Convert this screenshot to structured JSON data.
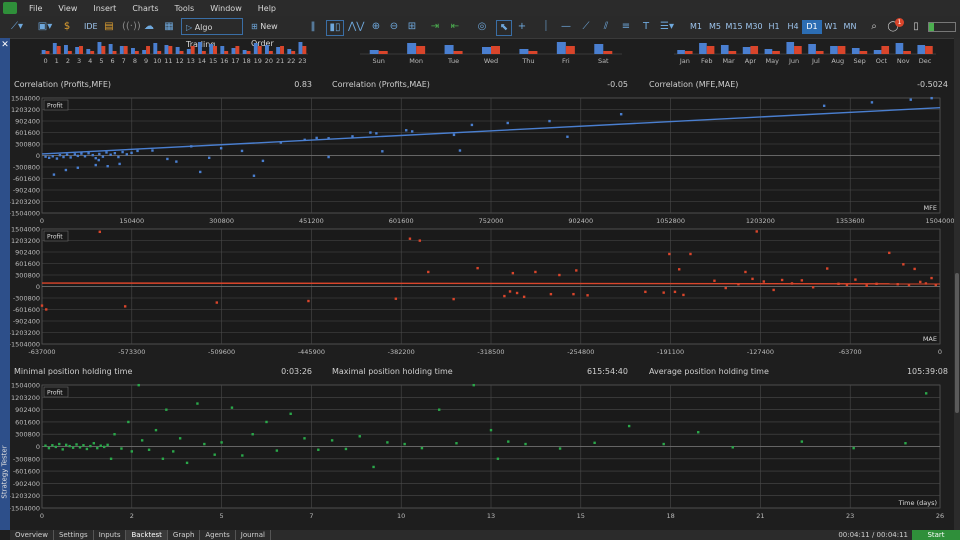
{
  "menu": [
    "File",
    "View",
    "Insert",
    "Charts",
    "Tools",
    "Window",
    "Help"
  ],
  "toolbar": {
    "ide": "IDE",
    "algo": "Algo Trading",
    "new_order": "New Order",
    "timeframes": [
      "M1",
      "M5",
      "M15",
      "M30",
      "H1",
      "H4",
      "D1",
      "W1",
      "MN"
    ],
    "active_tf": "D1",
    "notif_count": "1"
  },
  "top_hist": {
    "hours": [
      "0",
      "1",
      "2",
      "3",
      "4",
      "5",
      "6",
      "7",
      "8",
      "9",
      "10",
      "11",
      "12",
      "13",
      "14",
      "15",
      "16",
      "17",
      "18",
      "19",
      "20",
      "21",
      "22",
      "23"
    ],
    "days": [
      "Sun",
      "Mon",
      "Tue",
      "Wed",
      "Thu",
      "Fri",
      "Sat"
    ],
    "months": [
      "Jan",
      "Feb",
      "Mar",
      "Apr",
      "May",
      "Jun",
      "Jul",
      "Aug",
      "Sep",
      "Oct",
      "Nov",
      "Dec"
    ]
  },
  "stats1": [
    {
      "label": "Correlation (Profits,MFE)",
      "value": "0.83"
    },
    {
      "label": "Correlation (Profits,MAE)",
      "value": "-0.05"
    },
    {
      "label": "Correlation (MFE,MAE)",
      "value": "-0.5024"
    }
  ],
  "stats2": [
    {
      "label": "Minimal position holding time",
      "value": "0:03:26"
    },
    {
      "label": "Maximal position holding time",
      "value": "615:54:40"
    },
    {
      "label": "Average position holding time",
      "value": "105:39:08"
    }
  ],
  "colors": {
    "mfe": "#4a7fd0",
    "mae": "#d9452b",
    "time": "#2aa84a",
    "buy": "#4a7fd0",
    "sell": "#d9452b"
  },
  "chart_data": [
    {
      "type": "scatter",
      "title": "",
      "legend": "Profit",
      "xlabel": "MFE",
      "ylabel": "",
      "yticks": [
        "1504000",
        "1203200",
        "902400",
        "601600",
        "300800",
        "0",
        "-300800",
        "-601600",
        "-902400",
        "-1203200",
        "-1504000"
      ],
      "xticks": [
        "0",
        "150400",
        "300800",
        "451200",
        "601600",
        "752000",
        "902400",
        "1052800",
        "1203200",
        "1353600",
        "1504000"
      ],
      "xlim": [
        0,
        1504000
      ],
      "ylim": [
        -1504000,
        1504000
      ],
      "trend": [
        [
          0,
          40000
        ],
        [
          1504000,
          1250000
        ]
      ],
      "points": [
        [
          6000,
          -30000
        ],
        [
          12000,
          -60000
        ],
        [
          18000,
          -20000
        ],
        [
          25000,
          -80000
        ],
        [
          30000,
          10000
        ],
        [
          36000,
          -40000
        ],
        [
          42000,
          20000
        ],
        [
          48000,
          -50000
        ],
        [
          55000,
          30000
        ],
        [
          60000,
          -10000
        ],
        [
          66000,
          50000
        ],
        [
          72000,
          -20000
        ],
        [
          78000,
          60000
        ],
        [
          85000,
          10000
        ],
        [
          90000,
          -70000
        ],
        [
          96000,
          40000
        ],
        [
          102000,
          -30000
        ],
        [
          108000,
          80000
        ],
        [
          115000,
          20000
        ],
        [
          122000,
          60000
        ],
        [
          128000,
          -40000
        ],
        [
          135000,
          90000
        ],
        [
          142000,
          30000
        ],
        [
          150000,
          70000
        ],
        [
          20000,
          -500000
        ],
        [
          40000,
          -380000
        ],
        [
          60000,
          -320000
        ],
        [
          90000,
          -250000
        ],
        [
          110000,
          -280000
        ],
        [
          130000,
          -220000
        ],
        [
          95000,
          -120000
        ],
        [
          160000,
          120000
        ],
        [
          185000,
          130000
        ],
        [
          210000,
          -90000
        ],
        [
          225000,
          -160000
        ],
        [
          250000,
          240000
        ],
        [
          265000,
          -430000
        ],
        [
          280000,
          -60000
        ],
        [
          300000,
          190000
        ],
        [
          335000,
          120000
        ],
        [
          355000,
          -530000
        ],
        [
          370000,
          -140000
        ],
        [
          400000,
          340000
        ],
        [
          440000,
          410000
        ],
        [
          460000,
          460000
        ],
        [
          480000,
          450000
        ],
        [
          520000,
          500000
        ],
        [
          480000,
          -40000
        ],
        [
          550000,
          600000
        ],
        [
          560000,
          580000
        ],
        [
          570000,
          110000
        ],
        [
          610000,
          660000
        ],
        [
          620000,
          630000
        ],
        [
          690000,
          540000
        ],
        [
          720000,
          800000
        ],
        [
          700000,
          130000
        ],
        [
          780000,
          850000
        ],
        [
          850000,
          900000
        ],
        [
          880000,
          490000
        ],
        [
          970000,
          1080000
        ],
        [
          1310000,
          1300000
        ],
        [
          1390000,
          1390000
        ],
        [
          1455000,
          1460000
        ],
        [
          1490000,
          1500000
        ]
      ]
    },
    {
      "type": "scatter",
      "title": "",
      "legend": "Profit",
      "xlabel": "MAE",
      "ylabel": "",
      "yticks": [
        "1504000",
        "1203200",
        "902400",
        "601600",
        "300800",
        "0",
        "-300800",
        "-601600",
        "-902400",
        "-1203200",
        "-1504000"
      ],
      "xticks": [
        "-637000",
        "-573300",
        "-509600",
        "-445900",
        "-382200",
        "-318500",
        "-254800",
        "-191100",
        "-127400",
        "-63700",
        "0"
      ],
      "xlim": [
        -637000,
        0
      ],
      "ylim": [
        -1504000,
        1504000
      ],
      "trend": [
        [
          -637000,
          90000
        ],
        [
          0,
          70000
        ]
      ],
      "points": [
        [
          -637000,
          -500000
        ],
        [
          -634000,
          -600000
        ],
        [
          -596000,
          1430000
        ],
        [
          -578000,
          -520000
        ],
        [
          -513000,
          -420000
        ],
        [
          -448000,
          -380000
        ],
        [
          -386000,
          -320000
        ],
        [
          -376000,
          1250000
        ],
        [
          -369000,
          1200000
        ],
        [
          -363000,
          380000
        ],
        [
          -345000,
          -330000
        ],
        [
          -328000,
          480000
        ],
        [
          -309000,
          -250000
        ],
        [
          -305000,
          -130000
        ],
        [
          -303000,
          350000
        ],
        [
          -300000,
          -170000
        ],
        [
          -295000,
          -270000
        ],
        [
          -287000,
          380000
        ],
        [
          -276000,
          -200000
        ],
        [
          -270000,
          300000
        ],
        [
          -260000,
          -200000
        ],
        [
          -258000,
          420000
        ],
        [
          -250000,
          -230000
        ],
        [
          -209000,
          -140000
        ],
        [
          -196000,
          -160000
        ],
        [
          -192000,
          850000
        ],
        [
          -188000,
          -140000
        ],
        [
          -185000,
          450000
        ],
        [
          -182000,
          -220000
        ],
        [
          -177000,
          850000
        ],
        [
          -130000,
          1440000
        ],
        [
          -160000,
          150000
        ],
        [
          -152000,
          -40000
        ],
        [
          -143000,
          60000
        ],
        [
          -138000,
          380000
        ],
        [
          -133000,
          200000
        ],
        [
          -125000,
          130000
        ],
        [
          -118000,
          -90000
        ],
        [
          -112000,
          170000
        ],
        [
          -105000,
          80000
        ],
        [
          -98000,
          160000
        ],
        [
          -90000,
          -20000
        ],
        [
          -80000,
          470000
        ],
        [
          -72000,
          70000
        ],
        [
          -66000,
          40000
        ],
        [
          -60000,
          180000
        ],
        [
          -52000,
          20000
        ],
        [
          -45000,
          70000
        ],
        [
          -36000,
          880000
        ],
        [
          -30000,
          60000
        ],
        [
          -26000,
          580000
        ],
        [
          -22000,
          40000
        ],
        [
          -18000,
          460000
        ],
        [
          -14000,
          120000
        ],
        [
          -10000,
          80000
        ],
        [
          -6000,
          220000
        ],
        [
          -3000,
          40000
        ]
      ]
    },
    {
      "type": "scatter",
      "title": "",
      "legend": "Profit",
      "xlabel": "Time (days)",
      "ylabel": "",
      "yticks": [
        "1504000",
        "1203200",
        "902400",
        "601600",
        "300800",
        "0",
        "-300800",
        "-601600",
        "-902400",
        "-1203200",
        "-1504000"
      ],
      "xticks": [
        "0",
        "2",
        "5",
        "7",
        "10",
        "13",
        "15",
        "18",
        "21",
        "23",
        "26"
      ],
      "xlim": [
        0,
        26
      ],
      "ylim": [
        -1504000,
        1504000
      ],
      "points": [
        [
          0.1,
          20000
        ],
        [
          0.2,
          -40000
        ],
        [
          0.3,
          30000
        ],
        [
          0.4,
          -10000
        ],
        [
          0.5,
          60000
        ],
        [
          0.6,
          -70000
        ],
        [
          0.7,
          40000
        ],
        [
          0.8,
          10000
        ],
        [
          0.9,
          -30000
        ],
        [
          1.0,
          50000
        ],
        [
          1.1,
          -20000
        ],
        [
          1.2,
          30000
        ],
        [
          1.3,
          -60000
        ],
        [
          1.4,
          10000
        ],
        [
          1.5,
          80000
        ],
        [
          1.6,
          -40000
        ],
        [
          1.7,
          20000
        ],
        [
          1.8,
          -10000
        ],
        [
          1.9,
          40000
        ],
        [
          2.0,
          -300000
        ],
        [
          2.1,
          300000
        ],
        [
          2.3,
          -50000
        ],
        [
          2.5,
          600000
        ],
        [
          2.6,
          -120000
        ],
        [
          2.8,
          1500000
        ],
        [
          2.9,
          150000
        ],
        [
          3.1,
          -80000
        ],
        [
          3.3,
          400000
        ],
        [
          3.5,
          -300000
        ],
        [
          3.6,
          900000
        ],
        [
          3.8,
          -120000
        ],
        [
          4.0,
          200000
        ],
        [
          4.2,
          -400000
        ],
        [
          4.5,
          1050000
        ],
        [
          4.7,
          60000
        ],
        [
          5.0,
          -200000
        ],
        [
          5.2,
          100000
        ],
        [
          5.5,
          950000
        ],
        [
          5.8,
          -220000
        ],
        [
          6.1,
          300000
        ],
        [
          6.5,
          600000
        ],
        [
          6.8,
          -100000
        ],
        [
          7.2,
          800000
        ],
        [
          7.6,
          200000
        ],
        [
          8.0,
          -80000
        ],
        [
          8.4,
          150000
        ],
        [
          8.8,
          -60000
        ],
        [
          9.2,
          250000
        ],
        [
          9.6,
          -500000
        ],
        [
          10.0,
          100000
        ],
        [
          10.5,
          60000
        ],
        [
          11.0,
          -40000
        ],
        [
          11.5,
          900000
        ],
        [
          12.0,
          80000
        ],
        [
          12.5,
          1500000
        ],
        [
          13.0,
          400000
        ],
        [
          13.2,
          -300000
        ],
        [
          13.5,
          120000
        ],
        [
          14.0,
          60000
        ],
        [
          15.0,
          -50000
        ],
        [
          16.0,
          90000
        ],
        [
          17.0,
          500000
        ],
        [
          18.0,
          60000
        ],
        [
          19.0,
          350000
        ],
        [
          20.0,
          -20000
        ],
        [
          22.0,
          120000
        ],
        [
          23.5,
          -40000
        ],
        [
          25.0,
          80000
        ],
        [
          25.6,
          1300000
        ]
      ]
    }
  ],
  "bottom": {
    "tabs": [
      "Overview",
      "Settings",
      "Inputs",
      "Backtest",
      "Graph",
      "Agents",
      "Journal"
    ],
    "active": "Backtest",
    "time": "00:04:11 / 00:04:11",
    "start": "Start",
    "side_label": "Strategy Tester"
  }
}
